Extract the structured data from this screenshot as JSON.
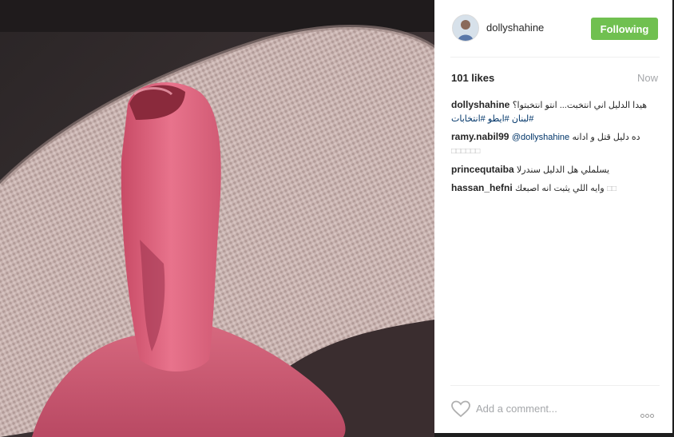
{
  "post": {
    "username": "dollyshahine",
    "follow_label": "Following",
    "likes": "101 likes",
    "time": "Now"
  },
  "caption": {
    "user": "dollyshahine",
    "text": "هيدا الدليل اني انتخبت... انتو انتخبتوا؟",
    "tags": "لبنان #ايطو #انتخابات#"
  },
  "comments": [
    {
      "user": "ramy.nabil99",
      "mention": "@dollyshahine",
      "text": "ده دليل قتل و ادانه",
      "extra": "□□□□□□"
    },
    {
      "user": "princequtaiba",
      "text": "يسلملي هل الدليل سندرلا"
    },
    {
      "user": "hassan_hefni",
      "text": "وايه اللي يثبت انه اصبعك",
      "extra": "□□"
    }
  ],
  "footer": {
    "comment_placeholder": "Add a comment..."
  },
  "icons": {
    "heart": "heart-outline-icon",
    "more": "more-options-icon"
  },
  "colors": {
    "follow_button": "#70c050",
    "link": "#003569",
    "muted": "#a5a7aa"
  }
}
